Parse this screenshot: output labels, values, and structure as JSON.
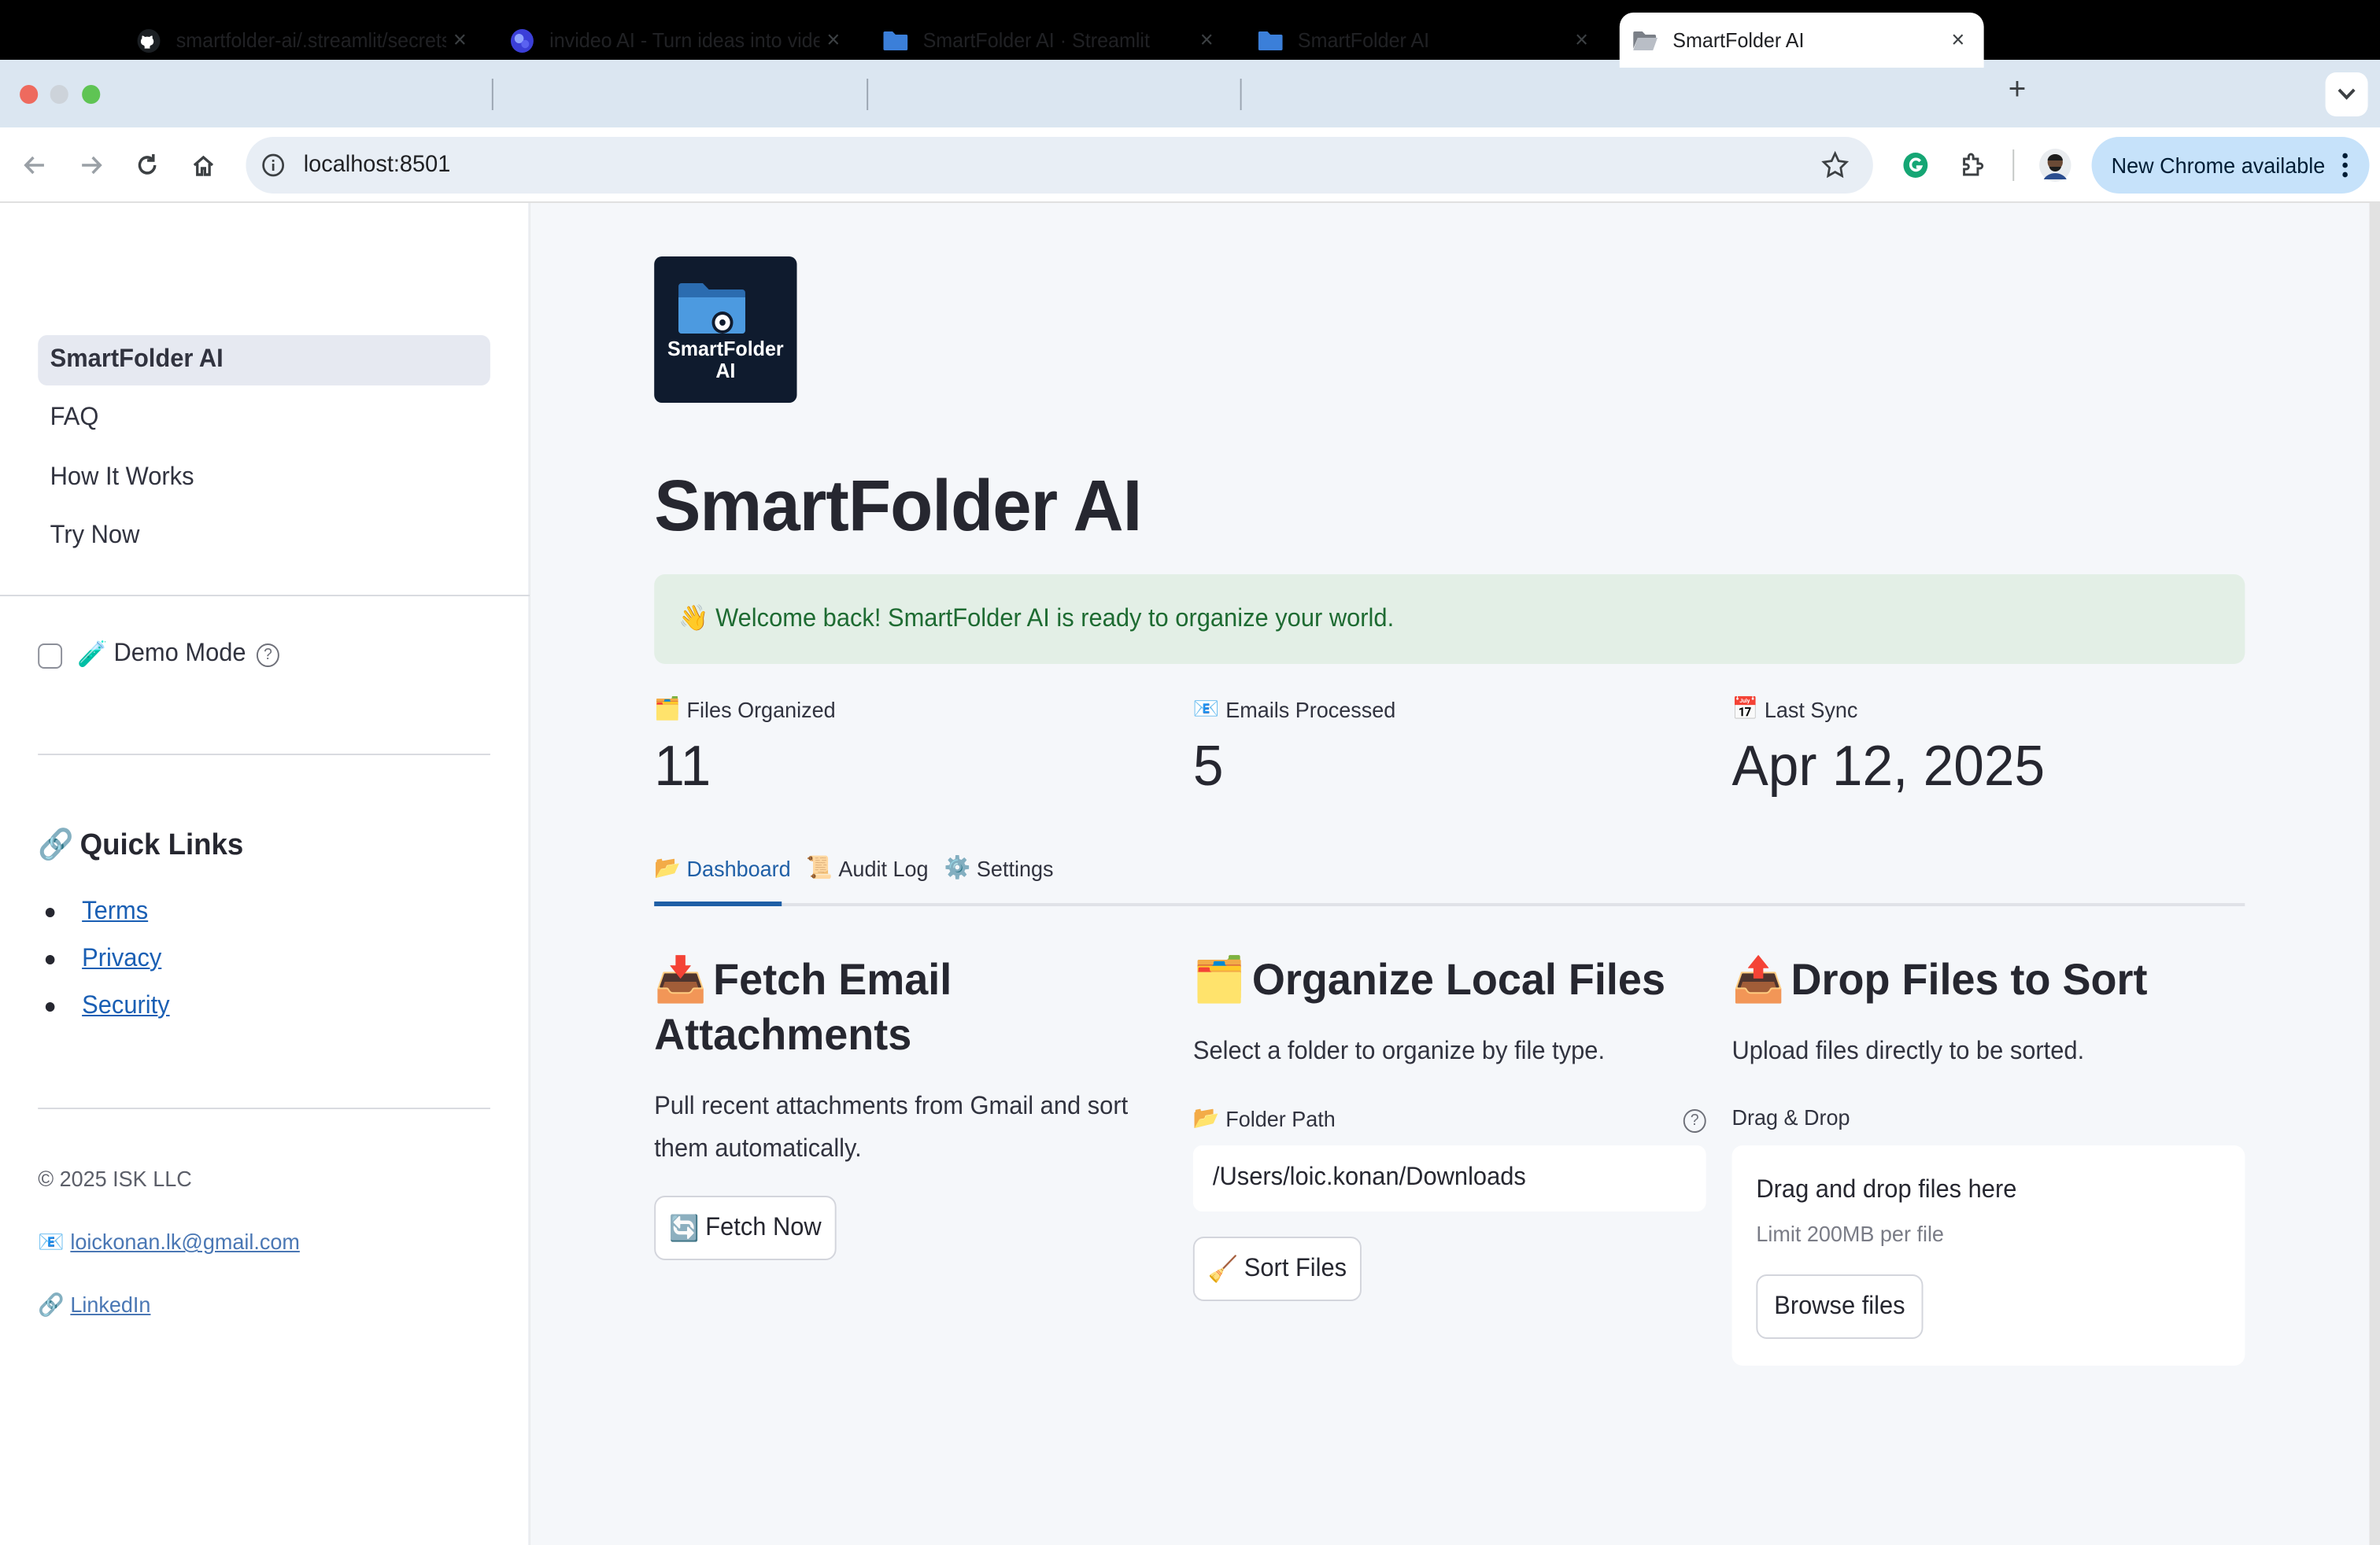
{
  "browser": {
    "tabs": [
      {
        "title": "smartfolder-ai/.streamlit/secrets.toml",
        "icon": "github-icon"
      },
      {
        "title": "invideo AI - Turn ideas into videos",
        "icon": "invideo-icon"
      },
      {
        "title": "SmartFolder AI · Streamlit",
        "icon": "folder-icon"
      },
      {
        "title": "SmartFolder AI",
        "icon": "folder-icon"
      },
      {
        "title": "SmartFolder AI",
        "icon": "folder-open-icon"
      }
    ],
    "new_tab": "+",
    "close": "×",
    "url": "localhost:8501",
    "update_label": "New Chrome available",
    "colors": {
      "tabstrip": "#dbe6f1",
      "update": "#c6e2fa"
    }
  },
  "sidebar": {
    "nav": [
      {
        "label": "SmartFolder AI",
        "active": true
      },
      {
        "label": "FAQ",
        "active": false
      },
      {
        "label": "How It Works",
        "active": false
      },
      {
        "label": "Try Now",
        "active": false
      }
    ],
    "demo_mode": {
      "emoji": "🧪",
      "label": "Demo Mode",
      "checked": false
    },
    "quick_links": {
      "emoji": "🔗",
      "title": "Quick Links",
      "items": [
        "Terms",
        "Privacy",
        "Security"
      ]
    },
    "footer": {
      "copyright": "© 2025 ISK LLC",
      "email_emoji": "📧",
      "email": "loickonan.lk@gmail.com",
      "linkedin_emoji": "🔗",
      "linkedin": "LinkedIn"
    }
  },
  "main": {
    "logo_text_line1": "SmartFolder",
    "logo_text_line2": "AI",
    "title": "SmartFolder AI",
    "banner": "👋 Welcome back! SmartFolder AI is ready to organize your world.",
    "metrics": [
      {
        "emoji": "🗂️",
        "label": "Files Organized",
        "value": "11"
      },
      {
        "emoji": "📧",
        "label": "Emails Processed",
        "value": "5"
      },
      {
        "emoji": "📅",
        "label": "Last Sync",
        "value": "Apr 12, 2025"
      }
    ],
    "tabs": [
      {
        "emoji": "📂",
        "label": "Dashboard",
        "active": true
      },
      {
        "emoji": "📜",
        "label": "Audit Log",
        "active": false
      },
      {
        "emoji": "⚙️",
        "label": "Settings",
        "active": false
      }
    ],
    "fetch": {
      "emoji": "📥",
      "title_line1": "Fetch Email",
      "title_line2": "Attachments",
      "desc_line1": "Pull recent attachments from Gmail and sort",
      "desc_line2": "them automatically.",
      "button_emoji": "🔄",
      "button": "Fetch Now"
    },
    "organize": {
      "emoji": "🗂️",
      "title": "Organize Local Files",
      "desc": "Select a folder to organize by file type.",
      "field_emoji": "📂",
      "field_label": "Folder Path",
      "field_value": "/Users/loic.konan/Downloads",
      "button_emoji": "🧹",
      "button": "Sort Files"
    },
    "drop": {
      "emoji": "📤",
      "title": "Drop Files to Sort",
      "desc": "Upload files directly to be sorted.",
      "field_label": "Drag & Drop",
      "zone_title": "Drag and drop files here",
      "zone_limit": "Limit 200MB per file",
      "button": "Browse files"
    },
    "colors": {
      "accent": "#1f5fa6",
      "banner_bg": "#e3efe6",
      "banner_text": "#1e6b32",
      "bg": "#f5f7fa"
    }
  }
}
